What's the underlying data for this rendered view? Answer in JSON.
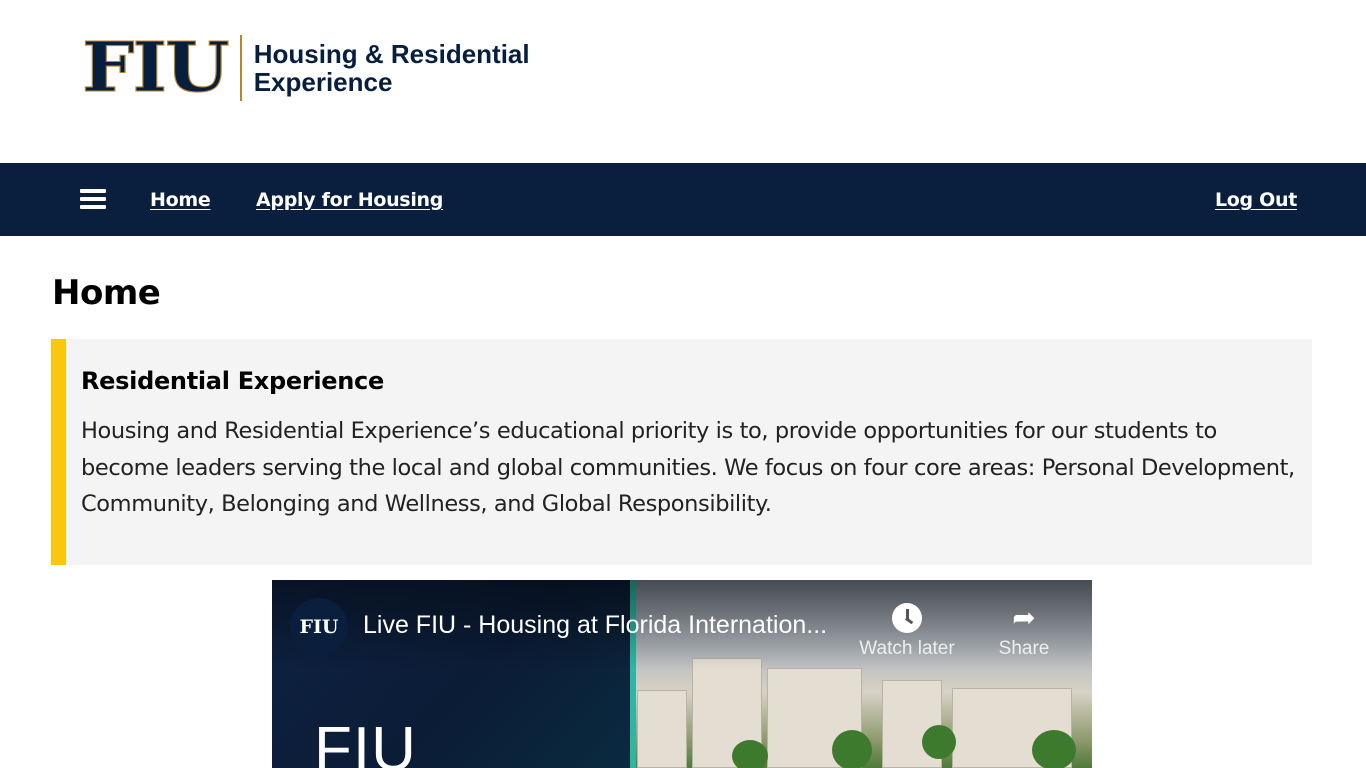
{
  "header": {
    "logo_mark": "FIU",
    "logo_line1": "Housing & Residential",
    "logo_line2": "Experience"
  },
  "nav": {
    "home": "Home",
    "apply": "Apply for Housing",
    "logout": "Log Out"
  },
  "page": {
    "title": "Home"
  },
  "callout": {
    "title": "Residential Experience",
    "body": "Housing and Residential Experience’s educational priority is to, provide opportunities for our students to become leaders serving the local and global communities. We focus on four core areas: Personal Development, Community, Belonging and Wellness, and Global Responsibility."
  },
  "video": {
    "channel_initials": "FIU",
    "title": "Live FIU - Housing at Florida Internation...",
    "watch_later": "Watch later",
    "share": "Share",
    "brand_text": "FIU"
  },
  "colors": {
    "navy": "#0a1e3e",
    "gold": "#b6862c",
    "accent_yellow": "#f9c80e",
    "callout_bg": "#f4f4f4"
  },
  "icons": {
    "menu": "hamburger-icon",
    "watch_later": "clock-icon",
    "share": "share-arrow-icon"
  }
}
